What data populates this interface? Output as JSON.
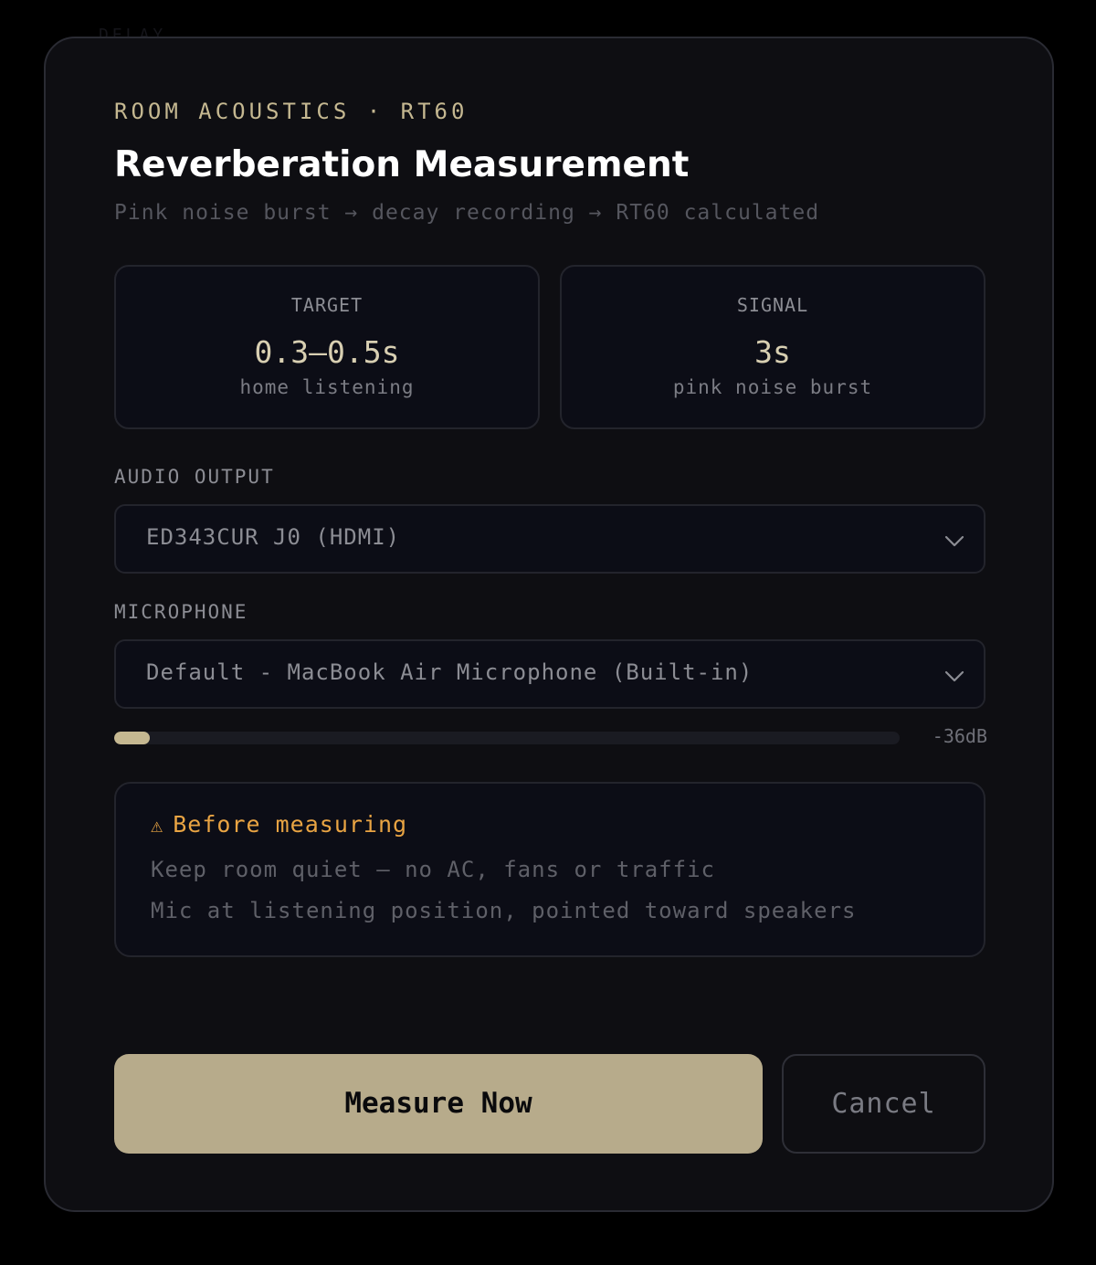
{
  "background": {
    "faint_text": "DELAY"
  },
  "header": {
    "eyebrow": "ROOM ACOUSTICS · RT60",
    "title": "Reverberation Measurement",
    "subtitle": "Pink noise burst → decay recording → RT60 calculated"
  },
  "stats": [
    {
      "label": "TARGET",
      "value": "0.3–0.5s",
      "sub": "home listening"
    },
    {
      "label": "SIGNAL",
      "value": "3s",
      "sub": "pink noise burst"
    }
  ],
  "audio_output": {
    "label": "AUDIO OUTPUT",
    "selected": "ED343CUR J0 (HDMI)"
  },
  "microphone": {
    "label": "MICROPHONE",
    "selected": "Default - MacBook Air Microphone (Built-in)"
  },
  "input_meter": {
    "level_fraction": 0.045,
    "readout": "-36dB"
  },
  "notice": {
    "icon": "warning-icon",
    "title": "Before measuring",
    "lines": [
      "Keep room quiet — no AC, fans or traffic",
      "Mic at listening position, pointed toward speakers"
    ]
  },
  "actions": {
    "primary_label": "Measure Now",
    "secondary_label": "Cancel"
  },
  "colors": {
    "accent": "#c5b891",
    "primary_button": "#b7ab8b",
    "warning": "#e9a443",
    "panel": "#0e0e12"
  }
}
